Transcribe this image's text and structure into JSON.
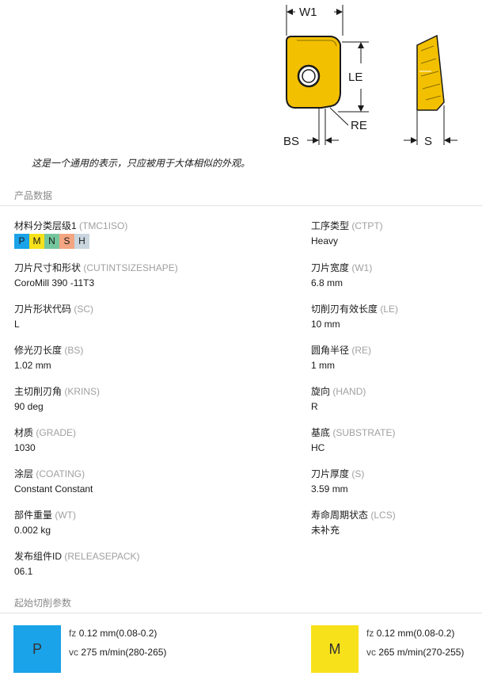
{
  "drawing": {
    "labels": {
      "w1": "W1",
      "le": "LE",
      "re": "RE",
      "bs": "BS",
      "s": "S"
    },
    "colors": {
      "insert": "#f3c000",
      "outline": "#1a1a1a"
    }
  },
  "caption": "这是一个通用的表示，只应被用于大体相似的外观。",
  "product_data": {
    "title": "产品数据",
    "properties": {
      "tmc1iso": {
        "label": "材料分类层级1",
        "code": "(TMC1ISO)"
      },
      "ctpt": {
        "label": "工序类型",
        "code": "(CTPT)",
        "value": "Heavy"
      },
      "cutintsizeshape": {
        "label": "刀片尺寸和形状",
        "code": "(CUTINTSIZESHAPE)",
        "value": "CoroMill 390 -11T3"
      },
      "w1": {
        "label": "刀片宽度",
        "code": "(W1)",
        "value": "6.8 mm"
      },
      "sc": {
        "label": "刀片形状代码",
        "code": "(SC)",
        "value": "L"
      },
      "le": {
        "label": "切削刃有效长度",
        "code": "(LE)",
        "value": "10 mm"
      },
      "bs": {
        "label": "修光刃长度",
        "code": "(BS)",
        "value": "1.02 mm"
      },
      "re": {
        "label": "圆角半径",
        "code": "(RE)",
        "value": "1 mm"
      },
      "krins": {
        "label": "主切削刃角",
        "code": "(KRINS)",
        "value": "90 deg"
      },
      "hand": {
        "label": "旋向",
        "code": "(HAND)",
        "value": "R"
      },
      "grade": {
        "label": "材质",
        "code": "(GRADE)",
        "value": "1030"
      },
      "substrate": {
        "label": "基底",
        "code": "(SUBSTRATE)",
        "value": "HC"
      },
      "coating": {
        "label": "涂层",
        "code": "(COATING)",
        "value": "Constant Constant"
      },
      "s": {
        "label": "刀片厚度",
        "code": "(S)",
        "value": "3.59 mm"
      },
      "wt": {
        "label": "部件重量",
        "code": "(WT)",
        "value": "0.002 kg"
      },
      "lcs": {
        "label": "寿命周期状态",
        "code": "(LCS)",
        "value": "未补充"
      },
      "releasepack": {
        "label": "发布组件ID",
        "code": "(RELEASEPACK)",
        "value": "06.1"
      }
    },
    "iso_chips": [
      {
        "letter": "P",
        "color": "#1aa3e8"
      },
      {
        "letter": "M",
        "color": "#f7e11a"
      },
      {
        "letter": "N",
        "color": "#74c69d"
      },
      {
        "letter": "S",
        "color": "#f4a582"
      },
      {
        "letter": "H",
        "color": "#c9d6df"
      }
    ]
  },
  "start_params": {
    "title": "起始切削参数",
    "cards": [
      {
        "letter": "P",
        "color": "#1aa3e8",
        "fz": {
          "label": "fz",
          "value": "0.12",
          "unit": "mm",
          "range": "(0.08-0.2)"
        },
        "vc": {
          "label": "vc",
          "value": "275",
          "unit": "m/min",
          "range": "(280-265)"
        }
      },
      {
        "letter": "M",
        "color": "#f7e11a",
        "fz": {
          "label": "fz",
          "value": "0.12",
          "unit": "mm",
          "range": "(0.08-0.2)"
        },
        "vc": {
          "label": "vc",
          "value": "265",
          "unit": "m/min",
          "range": "(270-255)"
        }
      }
    ]
  }
}
